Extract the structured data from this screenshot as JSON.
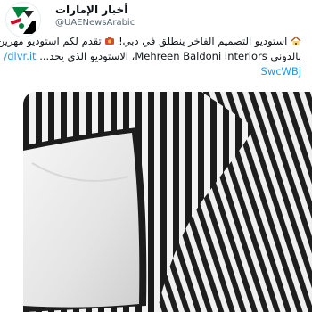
{
  "account": {
    "name": "أخبار الإمارات",
    "handle": "@UAENewsArabic"
  },
  "tweet": {
    "line1": "استوديو التصميم الفاخر ينطلق في دبي!",
    "line1b": "تقدم لكم استوديو مهرين",
    "line2": "بالدوني Mehreen Baldoni Interiors، الاستوديو الذي يحد...",
    "link_a": "dlvr.it/",
    "link_b": "SwcWBj"
  },
  "icons": {
    "house": "house-emoji-icon",
    "camera": "camera-emoji-icon",
    "avatar_flag": "uae-flag-icon"
  },
  "colors": {
    "link": "#1d9bf0",
    "flag_green": "#00843d",
    "flag_red": "#c8102e"
  }
}
